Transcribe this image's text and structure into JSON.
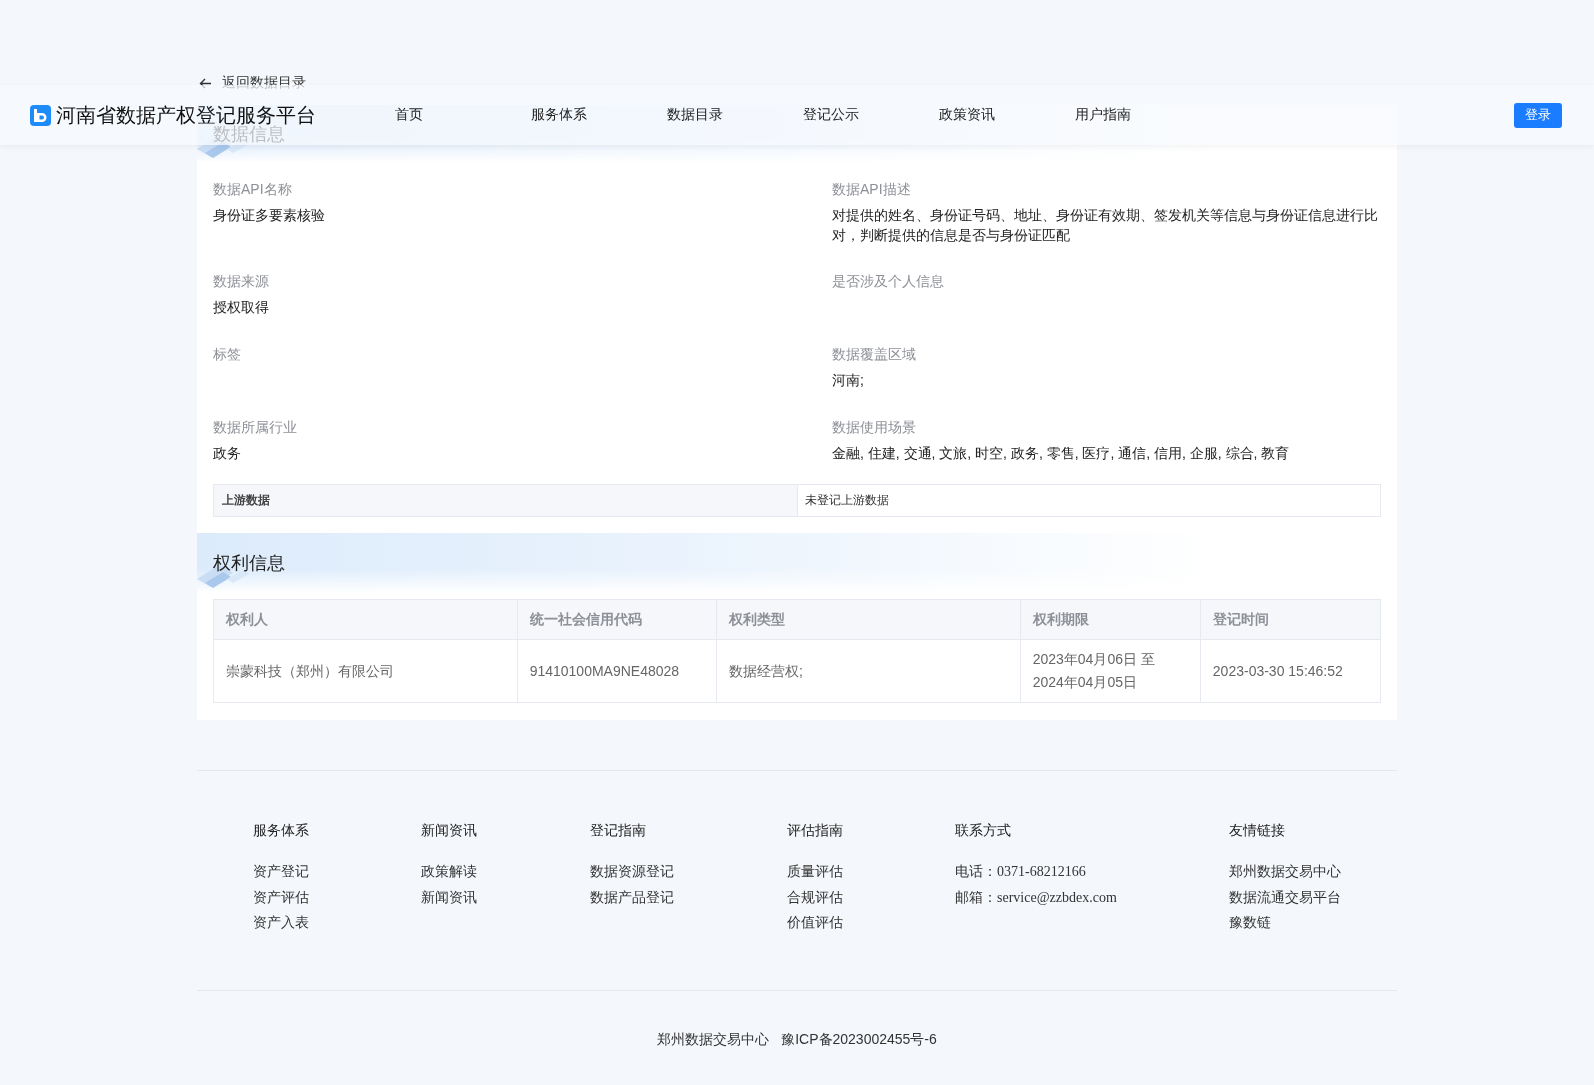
{
  "header": {
    "site_title": "河南省数据产权登记服务平台",
    "nav": [
      "首页",
      "服务体系",
      "数据目录",
      "登记公示",
      "政策资讯",
      "用户指南"
    ],
    "login_button": "登录"
  },
  "back_link": "返回数据目录",
  "data_info": {
    "title": "数据信息",
    "fields": [
      {
        "label": "数据API名称",
        "value": "身份证多要素核验"
      },
      {
        "label": "数据API描述",
        "value": "对提供的姓名、身份证号码、地址、身份证有效期、签发机关等信息与身份证信息进行比对，判断提供的信息是否与身份证匹配"
      },
      {
        "label": "数据来源",
        "value": "授权取得"
      },
      {
        "label": "是否涉及个人信息"
      },
      {
        "label": "标签"
      },
      {
        "label": "数据覆盖区域",
        "value": "河南;"
      },
      {
        "label": "数据所属行业",
        "value": "政务"
      },
      {
        "label": "数据使用场景",
        "value": "金融, 住建, 交通, 文旅, 时空, 政务, 零售, 医疗, 通信, 信用, 企服, 综合, 教育"
      }
    ],
    "upstream": {
      "label": "上游数据",
      "value": "未登记上游数据"
    }
  },
  "rights_info": {
    "title": "权利信息",
    "columns": [
      "权利人",
      "统一社会信用代码",
      "权利类型",
      "权利期限",
      "登记时间"
    ],
    "rows": [
      [
        "崇蒙科技（郑州）有限公司",
        "91410100MA9NE48028",
        "数据经营权;",
        "2023年04月06日 至 2024年04月05日",
        "2023-03-30 15:46:52"
      ]
    ]
  },
  "footer": {
    "columns": [
      {
        "title": "服务体系",
        "items": [
          "资产登记",
          "资产评估",
          "资产入表"
        ]
      },
      {
        "title": "新闻资讯",
        "items": [
          "政策解读",
          "新闻资讯"
        ]
      },
      {
        "title": "登记指南",
        "items": [
          "数据资源登记",
          "数据产品登记"
        ]
      },
      {
        "title": "评估指南",
        "items": [
          "质量评估",
          "合规评估",
          "价值评估"
        ]
      },
      {
        "title": "联系方式",
        "items": [
          "电话：0371-68212166",
          "邮箱：service@zzbdex.com"
        ]
      },
      {
        "title": "友情链接",
        "items": [
          "郑州数据交易中心",
          "数据流通交易平台",
          "豫数链"
        ]
      }
    ],
    "bottom": [
      "郑州数据交易中心",
      "豫ICP备2023002455号-6"
    ]
  }
}
